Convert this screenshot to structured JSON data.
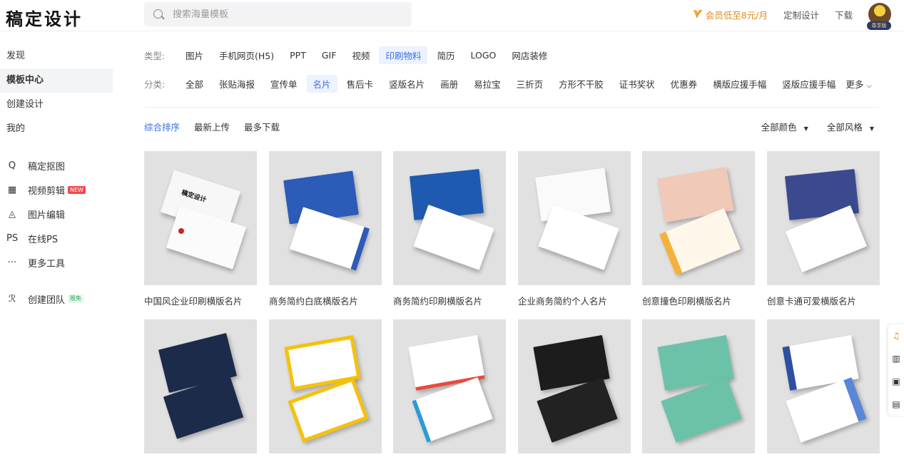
{
  "app": {
    "logo": "稿定设计"
  },
  "search": {
    "placeholder": "搜索海量模板"
  },
  "topnav": {
    "vip": "会员低至8元/月",
    "custom": "定制设计",
    "download": "下载",
    "avatar_badge": "尊享版"
  },
  "sidebar": {
    "items": [
      {
        "label": "发现"
      },
      {
        "label": "模板中心"
      },
      {
        "label": "创建设计"
      },
      {
        "label": "我的"
      }
    ],
    "tools": [
      {
        "label": "稿定抠图",
        "icon": "Q"
      },
      {
        "label": "视频剪辑",
        "icon": "▦",
        "tag": "NEW"
      },
      {
        "label": "图片编辑",
        "icon": "◬"
      },
      {
        "label": "在线PS",
        "icon": "PS"
      },
      {
        "label": "更多工具",
        "icon": "···"
      }
    ],
    "team": {
      "label": "创建团队",
      "icon": "ℛ",
      "tag": "限免"
    }
  },
  "filters": {
    "type_label": "类型:",
    "types": [
      "图片",
      "手机网页(H5)",
      "PPT",
      "GIF",
      "视频",
      "印刷物料",
      "简历",
      "LOGO",
      "网店装修"
    ],
    "category_label": "分类:",
    "categories": [
      "全部",
      "张贴海报",
      "宣传单",
      "名片",
      "售后卡",
      "竖版名片",
      "画册",
      "易拉宝",
      "三折页",
      "方形不干胶",
      "证书奖状",
      "优惠券",
      "横版应援手幅",
      "竖版应援手幅"
    ],
    "more": "更多"
  },
  "sort": {
    "options": [
      "综合排序",
      "最新上传",
      "最多下载"
    ],
    "color": "全部颜色",
    "style": "全部风格"
  },
  "templates": [
    {
      "title": "中国风企业印刷横版名片"
    },
    {
      "title": "商务简约白底横版名片"
    },
    {
      "title": "商务简约印刷横版名片"
    },
    {
      "title": "企业商务简约个人名片"
    },
    {
      "title": "创意撞色印刷横版名片"
    },
    {
      "title": "创意卡通可爱横版名片"
    },
    {
      "title": ""
    },
    {
      "title": ""
    },
    {
      "title": ""
    },
    {
      "title": ""
    },
    {
      "title": ""
    },
    {
      "title": ""
    }
  ],
  "colors": {
    "accent": "#3a6ee8",
    "vip": "#e08a1e"
  }
}
